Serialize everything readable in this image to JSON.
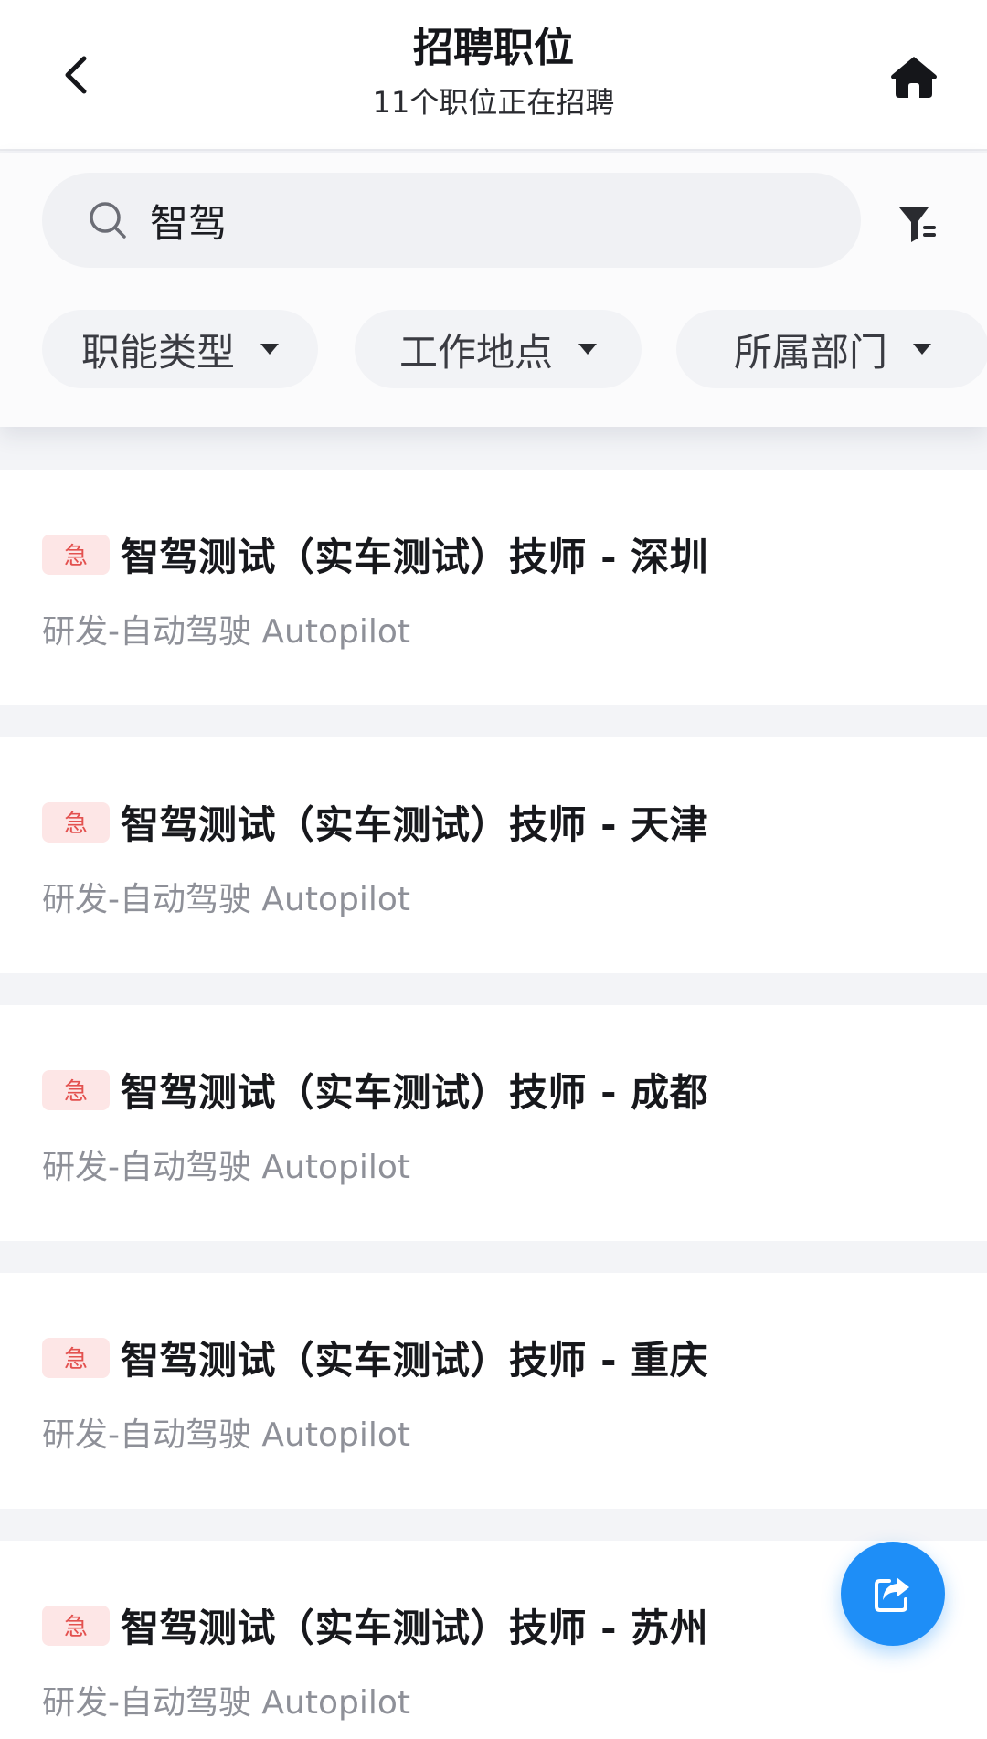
{
  "header": {
    "title": "招聘职位",
    "subtitle": "11个职位正在招聘"
  },
  "search": {
    "value": "智驾",
    "placeholder": ""
  },
  "filters": [
    {
      "label": "职能类型"
    },
    {
      "label": "工作地点"
    },
    {
      "label": "所属部门"
    }
  ],
  "jobs": [
    {
      "badge": "急",
      "title": "智驾测试（实车测试）技师 - 深圳",
      "department": "研发-自动驾驶 Autopilot"
    },
    {
      "badge": "急",
      "title": "智驾测试（实车测试）技师 - 天津",
      "department": "研发-自动驾驶 Autopilot"
    },
    {
      "badge": "急",
      "title": "智驾测试（实车测试）技师 - 成都",
      "department": "研发-自动驾驶 Autopilot"
    },
    {
      "badge": "急",
      "title": "智驾测试（实车测试）技师 - 重庆",
      "department": "研发-自动驾驶 Autopilot"
    },
    {
      "badge": "急",
      "title": "智驾测试（实车测试）技师 - 苏州",
      "department": "研发-自动驾驶 Autopilot"
    }
  ],
  "icons": {
    "back": "chevron-left-icon",
    "home": "home-icon",
    "search": "search-icon",
    "filter": "filter-icon",
    "share": "share-icon"
  },
  "colors": {
    "accent": "#1e8ef7",
    "urgent_text": "#e3514f",
    "urgent_bg": "#fde6e6",
    "title_text": "#17181c",
    "secondary_text": "#8e9098"
  }
}
